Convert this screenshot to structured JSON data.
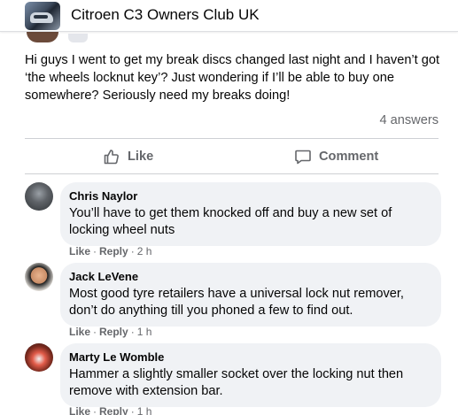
{
  "header": {
    "group_name": "Citroen C3 Owners Club UK",
    "group_image_icon": "group-cover-icon"
  },
  "post": {
    "text": "Hi guys I went to get my break discs changed last night and I haven’t got ‘the wheels locknut key’? Just wondering if I’ll be able to buy one somewhere? Seriously need my breaks doing!",
    "answers_count": "4 answers"
  },
  "actions": {
    "like_label": "Like",
    "like_icon": "thumbs-up-icon",
    "comment_label": "Comment",
    "comment_icon": "comment-bubble-icon"
  },
  "comments": [
    {
      "author": "Chris Naylor",
      "text": "You’ll have to get them knocked off and buy a new set of locking wheel nuts",
      "like": "Like",
      "reply": "Reply",
      "time": "2 h"
    },
    {
      "author": "Jack LeVene",
      "text": "Most good tyre retailers have a universal lock nut remover, don’t do anything till you phoned a few to find out.",
      "like": "Like",
      "reply": "Reply",
      "time": "1 h"
    },
    {
      "author": "Marty Le Womble",
      "text": "Hammer a slightly smaller socket over the locking nut then remove with extension bar.",
      "like": "Like",
      "reply": "Reply",
      "time": "1 h"
    }
  ],
  "colors": {
    "text_primary": "#050505",
    "text_secondary": "#65676b",
    "bubble_bg": "#f0f2f5",
    "divider": "#ced0d4"
  }
}
